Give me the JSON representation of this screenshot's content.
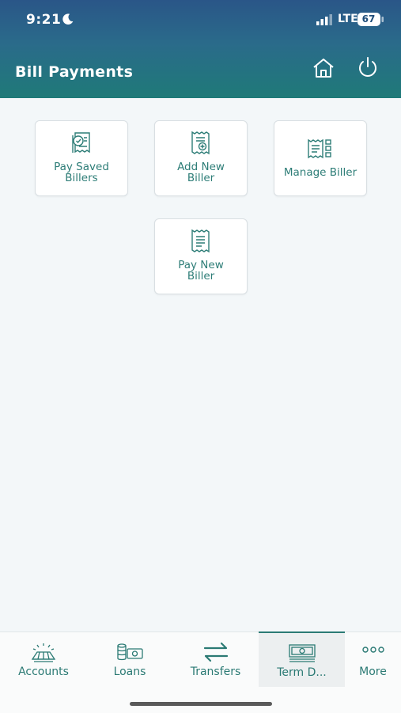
{
  "status_bar": {
    "time": "9:21",
    "network": "LTE",
    "battery": "67"
  },
  "header": {
    "title": "Bill Payments"
  },
  "tiles": [
    {
      "line1": "Pay Saved",
      "line2": "Billers",
      "icon": "receipt-check-icon"
    },
    {
      "line1": "Add New",
      "line2": "Biller",
      "icon": "receipt-add-icon"
    },
    {
      "line1": "Manage Biller",
      "line2": "",
      "icon": "manage-biller-icon"
    },
    {
      "line1": "Pay New",
      "line2": "Biller",
      "icon": "receipt-icon"
    }
  ],
  "tabs": [
    {
      "label": "Accounts",
      "icon": "accounts-icon"
    },
    {
      "label": "Loans",
      "icon": "loans-icon"
    },
    {
      "label": "Transfers",
      "icon": "transfers-icon"
    },
    {
      "label": "Term D...",
      "icon": "term-deposit-icon",
      "active": true
    },
    {
      "label": "More",
      "icon": "more-icon"
    }
  ],
  "colors": {
    "accent": "#2b7a74",
    "header_top": "#2a5688",
    "header_bottom": "#1f7a78"
  }
}
